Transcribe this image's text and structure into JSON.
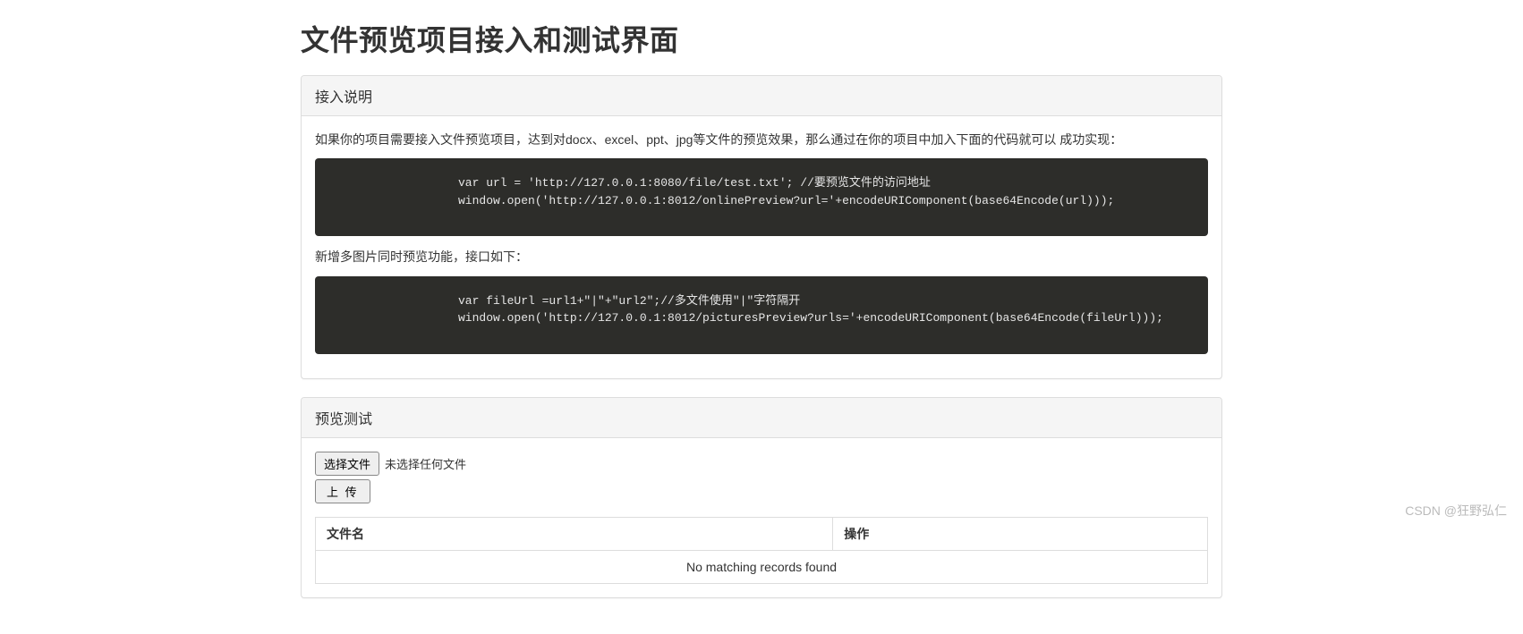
{
  "page": {
    "title": "文件预览项目接入和测试界面"
  },
  "panel1": {
    "heading": "接入说明",
    "intro1": "如果你的项目需要接入文件预览项目，达到对docx、excel、ppt、jpg等文件的预览效果，那么通过在你的项目中加入下面的代码就可以 成功实现：",
    "code1": "var url = 'http://127.0.0.1:8080/file/test.txt'; //要预览文件的访问地址\nwindow.open('http://127.0.0.1:8012/onlinePreview?url='+encodeURIComponent(base64Encode(url)));",
    "intro2": "新增多图片同时预览功能，接口如下：",
    "code2": "var fileUrl =url1+\"|\"+\"url2\";//多文件使用\"|\"字符隔开\nwindow.open('http://127.0.0.1:8012/picturesPreview?urls='+encodeURIComponent(base64Encode(fileUrl)));"
  },
  "panel2": {
    "heading": "预览测试",
    "chooseFileLabel": "选择文件",
    "noFileSelected": "未选择任何文件",
    "uploadLabel": "上 传",
    "table": {
      "col1": "文件名",
      "col2": "操作",
      "emptyMessage": "No matching records found"
    }
  },
  "watermark": "CSDN @狂野弘仁"
}
